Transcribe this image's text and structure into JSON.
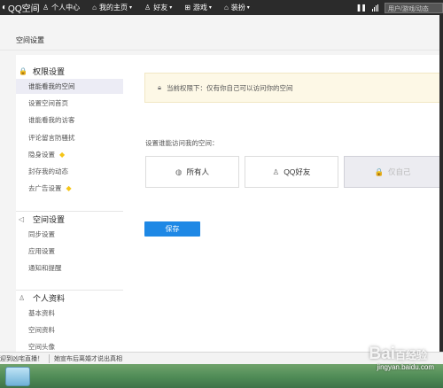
{
  "topbar": {
    "logo": "QQ空间",
    "nav": [
      {
        "icon": "person-icon",
        "glyph": "♙",
        "label": "个人中心",
        "caret": false
      },
      {
        "icon": "home-icon",
        "glyph": "⌂",
        "label": "我的主页",
        "caret": true
      },
      {
        "icon": "friends-icon",
        "glyph": "♙",
        "label": "好友",
        "caret": true
      },
      {
        "icon": "grid-icon",
        "glyph": "⊞",
        "label": "游戏",
        "caret": true
      },
      {
        "icon": "shirt-icon",
        "glyph": "⌂",
        "label": "装扮",
        "caret": true
      }
    ],
    "search_placeholder": "用户/游戏/动态"
  },
  "page_title": "空间设置",
  "sidebar": {
    "groups": [
      {
        "icon": "lock-icon",
        "glyph": "🔒",
        "title": "权限设置",
        "items": [
          {
            "label": "谁能看我的空间",
            "active": true,
            "vip": false
          },
          {
            "label": "设置空间首页",
            "active": false,
            "vip": false
          },
          {
            "label": "谁能看我的访客",
            "active": false,
            "vip": false
          },
          {
            "label": "评论留言防骚扰",
            "active": false,
            "vip": false
          },
          {
            "label": "隐身设置",
            "active": false,
            "vip": true
          },
          {
            "label": "封存我的动态",
            "active": false,
            "vip": false
          },
          {
            "label": "去广告设置",
            "active": false,
            "vip": true
          }
        ]
      },
      {
        "icon": "speaker-icon",
        "glyph": "◁",
        "title": "空间设置",
        "items": [
          {
            "label": "同步设置",
            "active": false,
            "vip": false
          },
          {
            "label": "应用设置",
            "active": false,
            "vip": false
          },
          {
            "label": "通知和提醒",
            "active": false,
            "vip": false
          }
        ]
      },
      {
        "icon": "user-card-icon",
        "glyph": "♙",
        "title": "个人资料",
        "items": [
          {
            "label": "基本资料",
            "active": false,
            "vip": false
          },
          {
            "label": "空间资料",
            "active": false,
            "vip": false
          },
          {
            "label": "空间头像",
            "active": false,
            "vip": false
          }
        ]
      }
    ]
  },
  "main": {
    "notice": "当前权限下：仅有你自己可以访问你的空间",
    "prompt": "设置谁能访问我的空间：",
    "options": [
      {
        "icon": "globe-icon",
        "glyph": "◍",
        "label": "所有人",
        "selected": false
      },
      {
        "icon": "friends-icon",
        "glyph": "♙",
        "label": "QQ好友",
        "selected": false
      },
      {
        "icon": "lock-icon",
        "glyph": "🔒",
        "label": "仅自己",
        "selected": true
      }
    ],
    "save_label": "保存"
  },
  "statusbar": {
    "left": "迎到凶宅直播！",
    "right": "她宣布后离婚才说出真相"
  },
  "watermark": {
    "logo": "Bai百经验",
    "url": "jingyan.baidu.com"
  },
  "colors": {
    "topbar_bg": "#2b2b2b",
    "save_button": "#1e88e5",
    "notice_bg": "#fdf8e6",
    "vip_diamond": "#f5c518",
    "active_item_bg": "#ececf5"
  }
}
